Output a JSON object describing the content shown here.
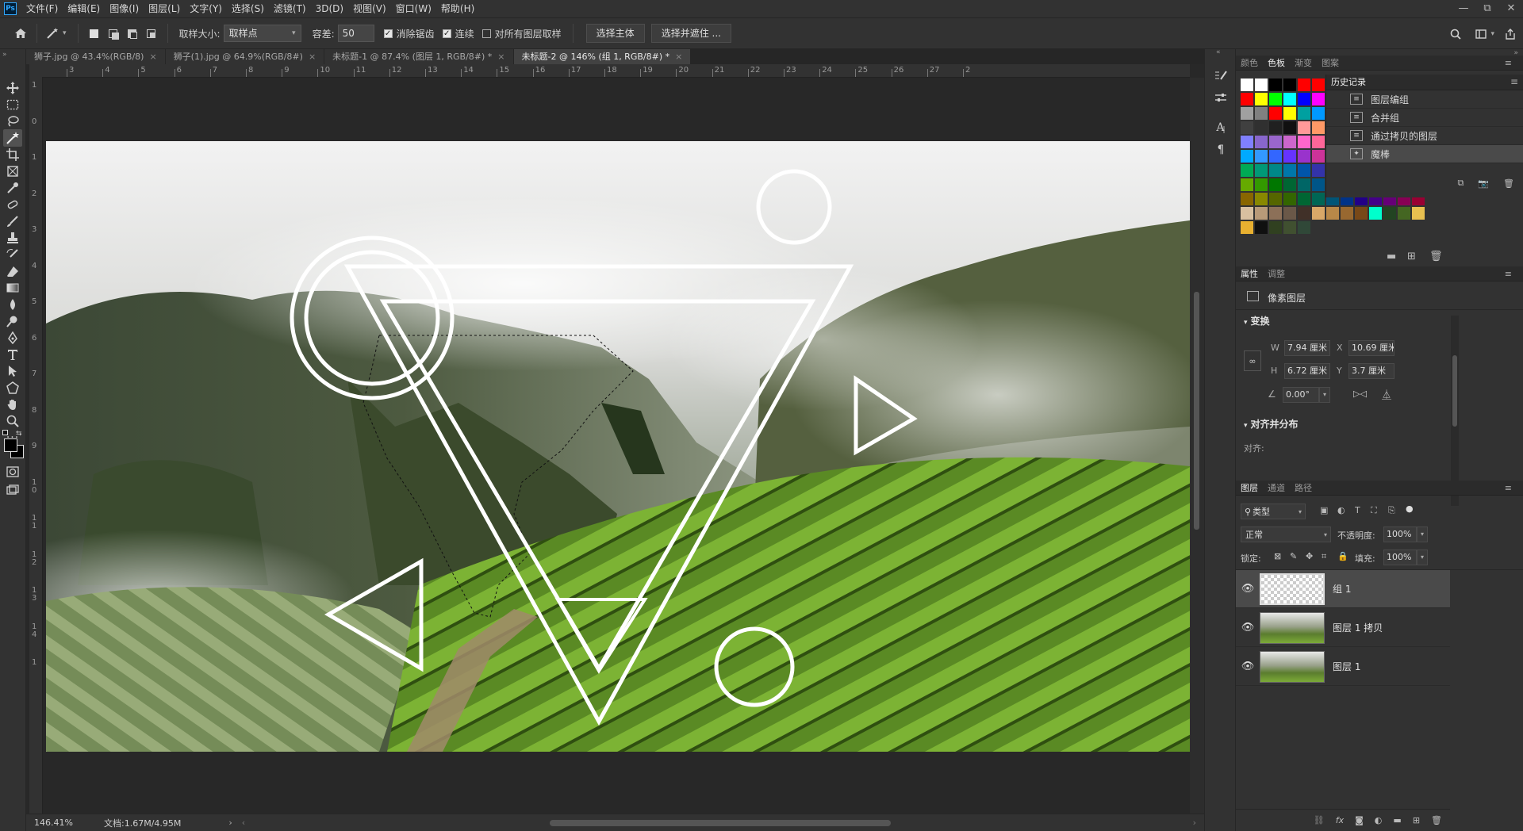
{
  "menubar": {
    "logo": "Ps",
    "items": [
      "文件(F)",
      "编辑(E)",
      "图像(I)",
      "图层(L)",
      "文字(Y)",
      "选择(S)",
      "滤镜(T)",
      "3D(D)",
      "视图(V)",
      "窗口(W)",
      "帮助(H)"
    ],
    "window_controls": [
      "—",
      "⧉",
      "✕"
    ]
  },
  "options": {
    "sample_size_label": "取样大小:",
    "sample_size_value": "取样点",
    "tolerance_label": "容差:",
    "tolerance_value": "50",
    "antialias_label": "消除锯齿",
    "antialias_checked": true,
    "contiguous_label": "连续",
    "contiguous_checked": true,
    "sample_all_label": "对所有图层取样",
    "sample_all_checked": false,
    "select_subject": "选择主体",
    "select_mask": "选择并遮住 ..."
  },
  "tabs": [
    {
      "label": "狮子.jpg @ 43.4%(RGB/8)",
      "active": false
    },
    {
      "label": "狮子(1).jpg @ 64.9%(RGB/8#)",
      "active": false
    },
    {
      "label": "未标题-1 @ 87.4% (图层 1, RGB/8#) *",
      "active": false
    },
    {
      "label": "未标题-2 @ 146% (组 1, RGB/8#) *",
      "active": true
    }
  ],
  "rulers": {
    "h_labels": [
      "3",
      "4",
      "5",
      "6",
      "7",
      "8",
      "9",
      "10",
      "11",
      "12",
      "13",
      "14",
      "15",
      "16",
      "17",
      "18",
      "19",
      "20",
      "21",
      "22",
      "23",
      "24",
      "25",
      "26",
      "27",
      "2"
    ],
    "v_labels": [
      "1",
      "0",
      "1",
      "2",
      "3",
      "4",
      "5",
      "6",
      "7",
      "8",
      "9",
      "10",
      "11",
      "12",
      "13",
      "14",
      "1"
    ]
  },
  "status": {
    "zoom": "146.41%",
    "doc": "文档:1.67M/4.95M",
    "arrow": "›"
  },
  "swatches_panel": {
    "tabs": [
      "颜色",
      "色板",
      "渐变",
      "图案"
    ],
    "active_tab": "色板",
    "rows": [
      [
        "#ffffff",
        "#ffffff",
        "#000000",
        "#000000",
        "#ff0000",
        "#ff0000"
      ],
      [
        "#ff0000",
        "#ffff00",
        "#00ff00",
        "#00ffff",
        "#0000ff",
        "#ff00ff"
      ],
      [
        "#a0a0a0",
        "#808080",
        "#ff0000",
        "#ffff00",
        "#00a0a0",
        "#0099ff"
      ],
      [
        "#404040",
        "#303030",
        "#202020",
        "#101010",
        "#ff9999",
        "#ff9966"
      ],
      [
        "#8080ff",
        "#8866cc",
        "#9966cc",
        "#cc66cc",
        "#ff66cc",
        "#ff6699"
      ],
      [
        "#00aaff",
        "#3399ff",
        "#3366ff",
        "#6633ff",
        "#9933cc",
        "#cc3399"
      ],
      [
        "#00aa55",
        "#009977",
        "#008888",
        "#0077aa",
        "#0055aa",
        "#3333aa"
      ],
      [
        "#66aa00",
        "#339900",
        "#007700",
        "#006633",
        "#006666",
        "#005588"
      ],
      [
        "#886600",
        "#888800",
        "#556600",
        "#336600",
        "#006633",
        "#006655",
        "#005577",
        "#003388",
        "#220088",
        "#440088",
        "#660077",
        "#880055",
        "#990033"
      ],
      [
        "#d8c0a0",
        "#b89a78",
        "#8c7058",
        "#6a5848",
        "#403028",
        "#d8a868",
        "#b88848",
        "#986830",
        "#784818",
        "#00ffcc",
        "#224422",
        "#446622",
        "#e8c050"
      ],
      [
        "#e8b030",
        "#101010",
        "#304020",
        "#405030",
        "#304838"
      ]
    ]
  },
  "history": {
    "title": "历史记录",
    "items": [
      {
        "label": "图层编组",
        "selected": false
      },
      {
        "label": "合并组",
        "selected": false
      },
      {
        "label": "通过拷贝的图层",
        "selected": false
      },
      {
        "label": "魔棒",
        "selected": true
      }
    ]
  },
  "properties": {
    "tabs": [
      "属性",
      "调整"
    ],
    "layer_type": "像素图层",
    "transform_title": "变换",
    "w_label": "W",
    "w_value": "7.94 厘米",
    "x_label": "X",
    "x_value": "10.69 厘米",
    "h_label": "H",
    "h_value": "6.72 厘米",
    "y_label": "Y",
    "y_value": "3.7 厘米",
    "angle_value": "0.00°",
    "align_title": "对齐并分布",
    "align_label": "对齐:"
  },
  "layers": {
    "tabs": [
      "图层",
      "通道",
      "路径"
    ],
    "filter_label": "类型",
    "blend_mode": "正常",
    "opacity_label": "不透明度:",
    "opacity_value": "100%",
    "lock_label": "锁定:",
    "fill_label": "填充:",
    "fill_value": "100%",
    "items": [
      {
        "name": "组 1",
        "selected": true,
        "thumb": "transparent"
      },
      {
        "name": "图层 1 拷贝",
        "selected": false,
        "thumb": "photo"
      },
      {
        "name": "图层 1",
        "selected": false,
        "thumb": "photo"
      }
    ]
  },
  "colors": {
    "ps_blue": "#31a8ff",
    "panel_bg": "#323232",
    "workspace_bg": "#282828",
    "selected_row": "#4a4a4a"
  }
}
